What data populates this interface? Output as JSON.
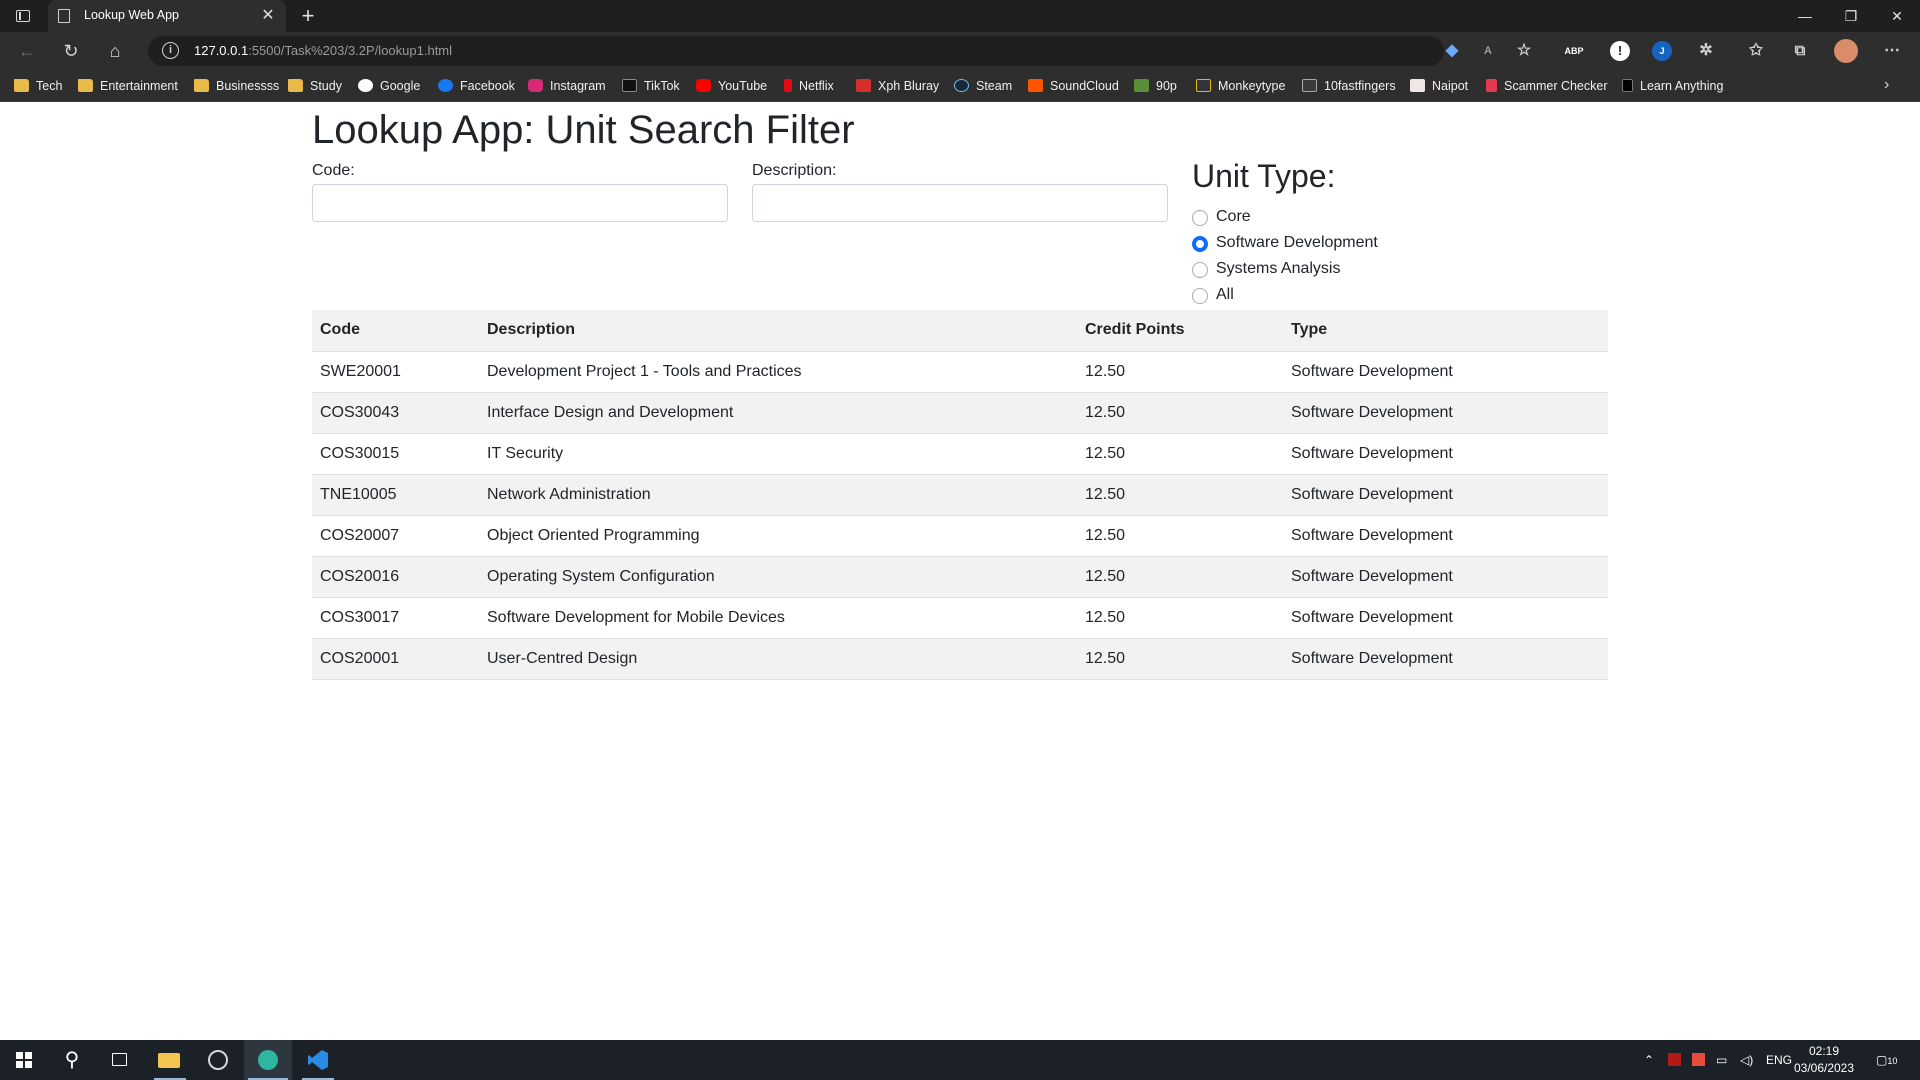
{
  "browser": {
    "tab_title": "Lookup Web App",
    "url_host": "127.0.0.1",
    "url_rest": ":5500/Task%203/3.2P/lookup1.html",
    "extensions": [
      {
        "name": "ABP",
        "color": "#c70d2c"
      },
      {
        "name": "J",
        "color": "#1565c0"
      }
    ],
    "bookmarks": [
      {
        "label": "Tech",
        "icon": "folder-icon"
      },
      {
        "label": "Entertainment",
        "icon": "folder-icon"
      },
      {
        "label": "Businessss",
        "icon": "folder-icon"
      },
      {
        "label": "Study",
        "icon": "folder-icon"
      },
      {
        "label": "Google",
        "icon": "google-icon"
      },
      {
        "label": "Facebook",
        "icon": "facebook-icon"
      },
      {
        "label": "Instagram",
        "icon": "instagram-icon"
      },
      {
        "label": "TikTok",
        "icon": "tiktok-icon"
      },
      {
        "label": "YouTube",
        "icon": "youtube-icon"
      },
      {
        "label": "Netflix",
        "icon": "netflix-icon"
      },
      {
        "label": "Xph Bluray",
        "icon": "xph-icon"
      },
      {
        "label": "Steam",
        "icon": "steam-icon"
      },
      {
        "label": "SoundCloud",
        "icon": "soundcloud-icon"
      },
      {
        "label": "90p",
        "icon": "90p-icon"
      },
      {
        "label": "Monkeytype",
        "icon": "monkeytype-icon"
      },
      {
        "label": "10fastfingers",
        "icon": "10fastfingers-icon"
      },
      {
        "label": "Naipot",
        "icon": "naipot-icon"
      },
      {
        "label": "Scammer Checker",
        "icon": "scammer-checker-icon"
      },
      {
        "label": "Learn Anything",
        "icon": "learn-anything-icon"
      }
    ]
  },
  "page": {
    "title": "Lookup App: Unit Search Filter",
    "code_label": "Code:",
    "code_value": "",
    "description_label": "Description:",
    "description_value": "",
    "unit_type_heading": "Unit Type:",
    "unit_types": [
      {
        "label": "Core",
        "checked": false
      },
      {
        "label": "Software Development",
        "checked": true
      },
      {
        "label": "Systems Analysis",
        "checked": false
      },
      {
        "label": "All",
        "checked": false
      }
    ],
    "table": {
      "headers": [
        "Code",
        "Description",
        "Credit Points",
        "Type"
      ],
      "rows": [
        [
          "SWE20001",
          "Development Project 1 - Tools and Practices",
          "12.50",
          "Software Development"
        ],
        [
          "COS30043",
          "Interface Design and Development",
          "12.50",
          "Software Development"
        ],
        [
          "COS30015",
          "IT Security",
          "12.50",
          "Software Development"
        ],
        [
          "TNE10005",
          "Network Administration",
          "12.50",
          "Software Development"
        ],
        [
          "COS20007",
          "Object Oriented Programming",
          "12.50",
          "Software Development"
        ],
        [
          "COS20016",
          "Operating System Configuration",
          "12.50",
          "Software Development"
        ],
        [
          "COS30017",
          "Software Development for Mobile Devices",
          "12.50",
          "Software Development"
        ],
        [
          "COS20001",
          "User-Centred Design",
          "12.50",
          "Software Development"
        ]
      ]
    }
  },
  "taskbar": {
    "language": "ENG",
    "time": "02:19",
    "date": "03/06/2023",
    "notifications": "10",
    "accent_color": "#0d6efd"
  }
}
